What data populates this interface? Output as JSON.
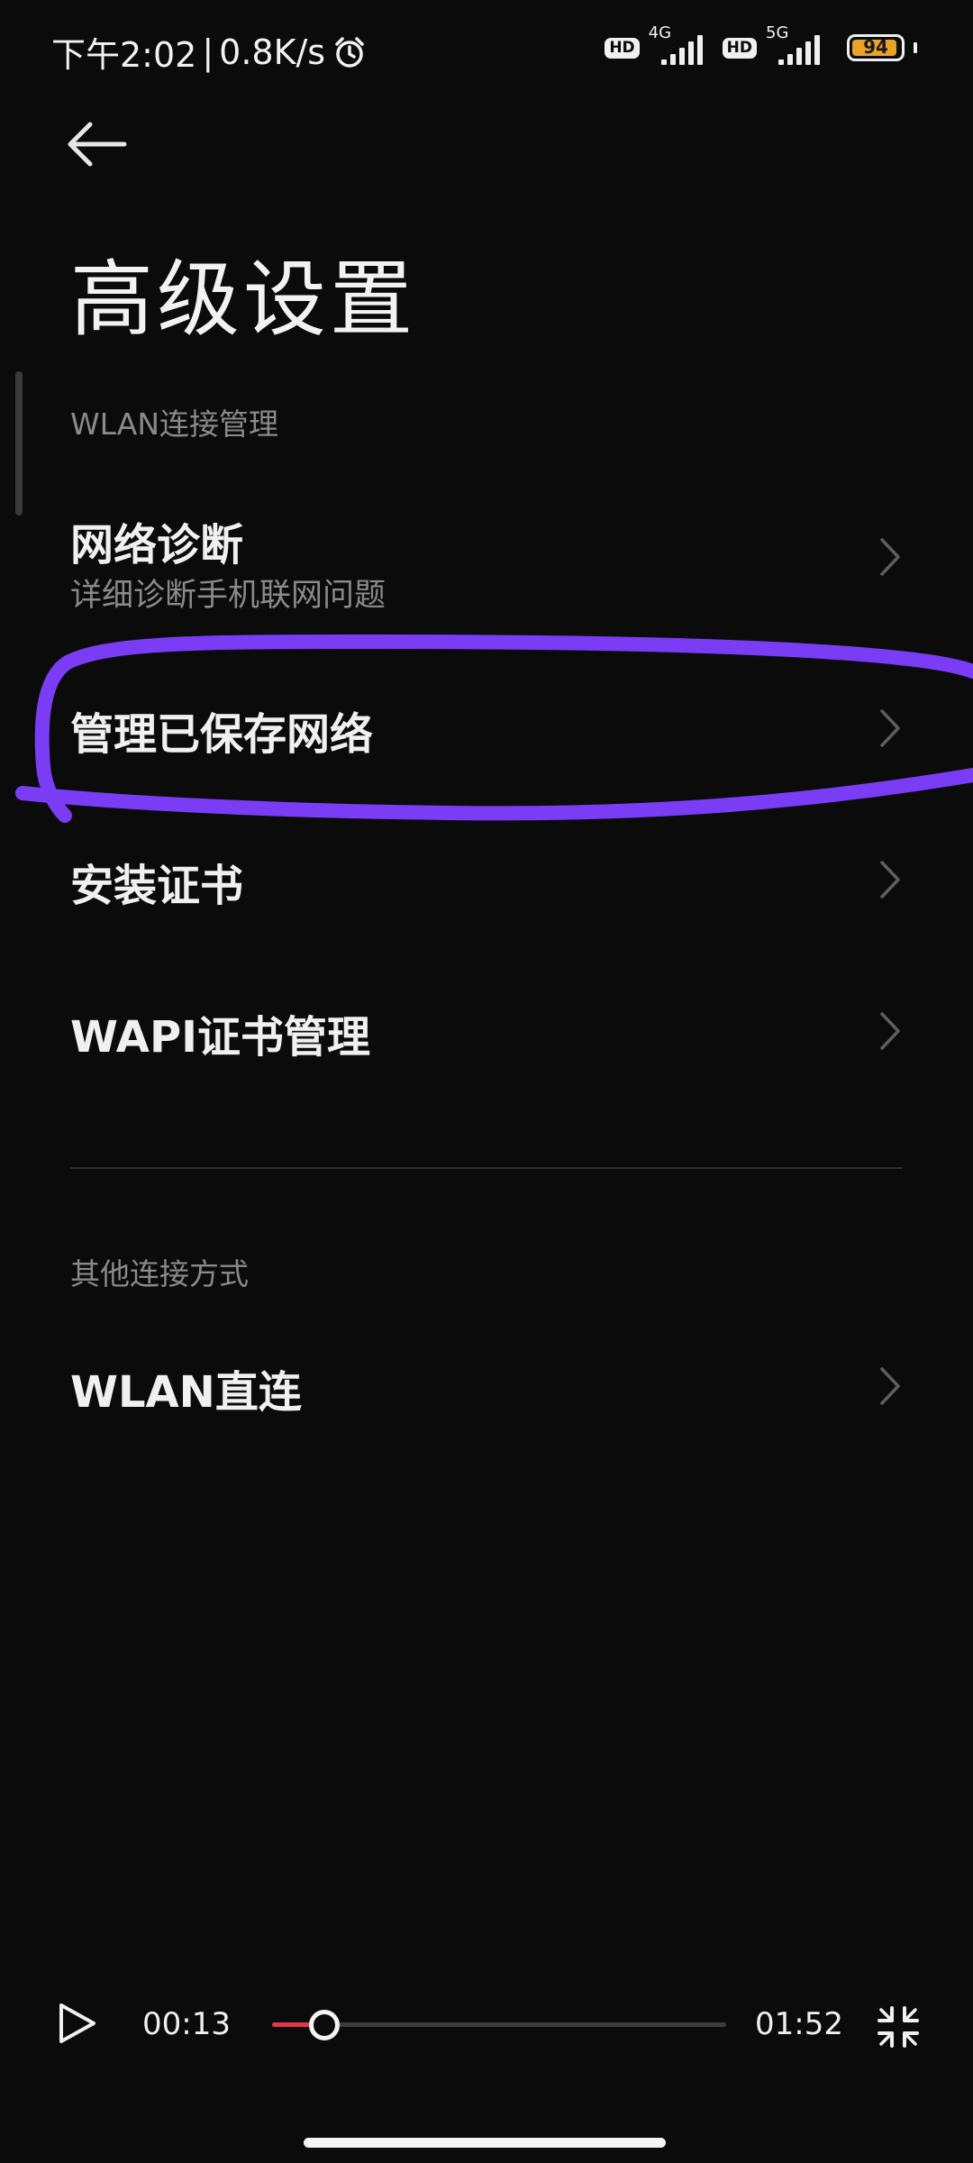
{
  "status_bar": {
    "time": "下午2:02",
    "separator": "|",
    "net_speed": "0.8K/s",
    "hd_label": "HD",
    "sim1_network": "4G",
    "sim2_network": "5G",
    "battery_percent": "94",
    "battery_level": 0.94,
    "battery_color": "#e8a32a"
  },
  "page": {
    "title": "高级设置"
  },
  "sections": [
    {
      "header": "WLAN连接管理",
      "items": [
        {
          "title": "网络诊断",
          "subtitle": "详细诊断手机联网问题"
        },
        {
          "title": "管理已保存网络"
        },
        {
          "title": "安装证书"
        },
        {
          "title": "WAPI证书管理"
        }
      ]
    },
    {
      "header": "其他连接方式",
      "items": [
        {
          "title": "WLAN直连"
        }
      ]
    }
  ],
  "annotation": {
    "color": "#7b3cf5",
    "marks": "管理已保存网络"
  },
  "player": {
    "elapsed": "00:13",
    "total": "01:52",
    "progress": 0.116,
    "progress_color": "#e03a4a"
  }
}
